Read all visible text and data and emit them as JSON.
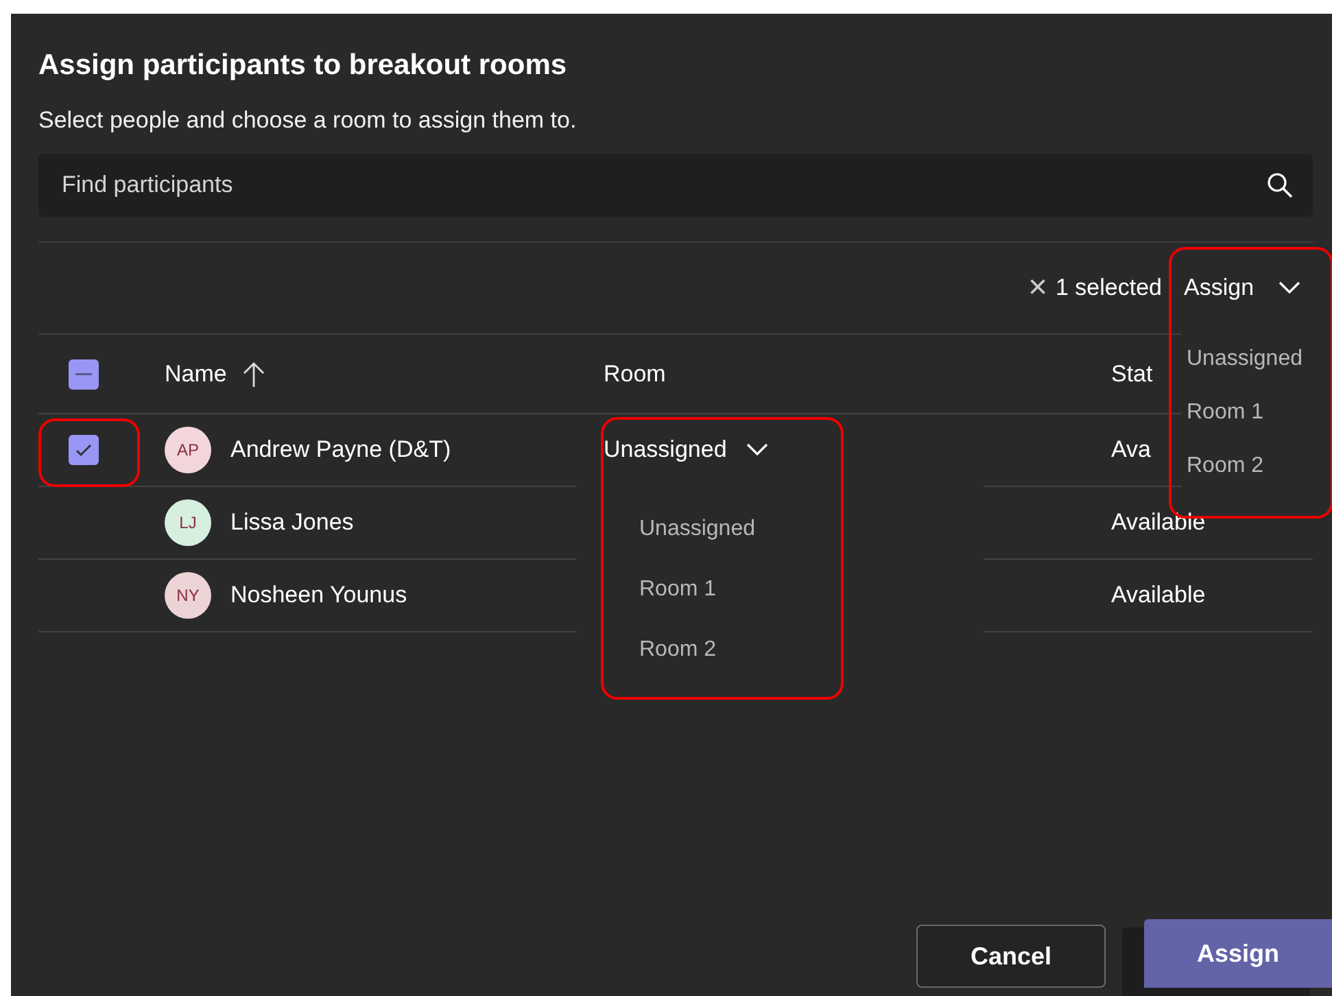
{
  "dialog": {
    "title": "Assign participants to breakout rooms",
    "subtitle": "Select people and choose a room to assign them to."
  },
  "search": {
    "placeholder": "Find participants"
  },
  "toolbar": {
    "clear_icon": "×",
    "selection": "1 selected",
    "assign": "Assign",
    "assign_menu": [
      "Unassigned",
      "Room 1",
      "Room 2"
    ]
  },
  "table": {
    "select_all_partial": true,
    "columns": [
      {
        "label": "Name",
        "sorted": true
      },
      {
        "label": "Room",
        "sorted": false
      },
      {
        "label": "Stat",
        "sorted": false
      }
    ],
    "rows": [
      {
        "selected": true,
        "initials": "AP",
        "color": "#f3d6dc",
        "name": "Andrew Payne (D&T)",
        "room": "Unassigned",
        "status": "Ava"
      },
      {
        "selected": false,
        "initials": "LJ",
        "color": "#d6efdf",
        "name": "Lissa Jones",
        "room": "",
        "status": "Available"
      },
      {
        "selected": false,
        "initials": "NY",
        "color": "#ecd3d6",
        "name": "Nosheen Younus",
        "room": "",
        "status": "Available"
      }
    ]
  },
  "room_menu": {
    "open": true,
    "options": [
      "Unassigned",
      "Room 1",
      "Room 2"
    ]
  },
  "buttons": [
    {
      "label": "Cancel",
      "kind": "secondary"
    },
    {
      "label": "Assign",
      "kind": "primary"
    }
  ]
}
